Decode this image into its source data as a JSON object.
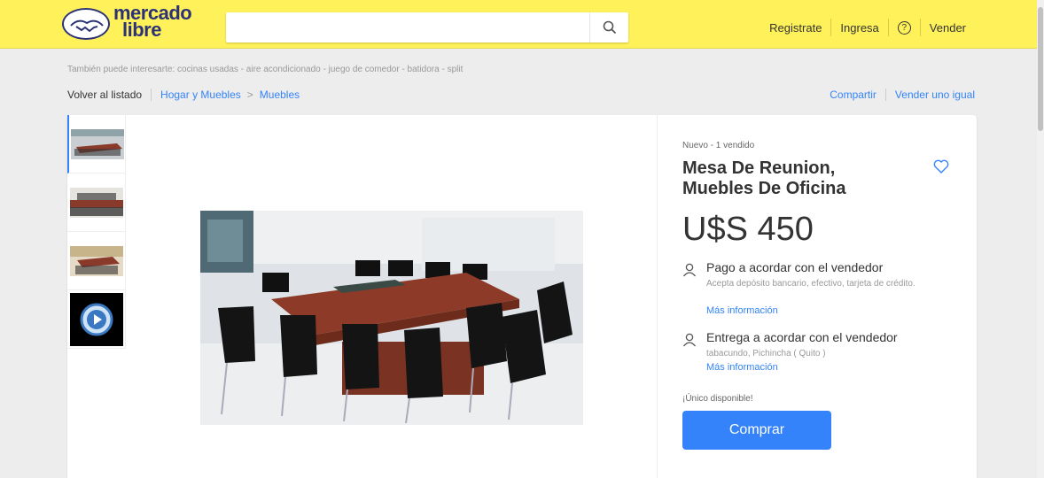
{
  "header": {
    "logo_line1": "mercado",
    "logo_line2": "libre",
    "search_placeholder": "",
    "nav": {
      "register": "Registrate",
      "login": "Ingresa",
      "help": "?",
      "sell": "Vender"
    }
  },
  "related": "También puede interesarte: cocinas usadas - aire acondicionado - juego de comedor - batidora - split",
  "breadcrumb": {
    "back": "Volver al listado",
    "cat1": "Hogar y Muebles",
    "cat2": "Muebles"
  },
  "actions": {
    "share": "Compartir",
    "sell_same": "Vender uno igual"
  },
  "product": {
    "condition": "Nuevo - 1 vendido",
    "title": "Mesa De Reunion, Muebles De Oficina",
    "price": "U$S 450",
    "payment": {
      "title": "Pago a acordar con el vendedor",
      "detail": "Acepta depósito bancario, efectivo, tarjeta de crédito.",
      "more": "Más información"
    },
    "delivery": {
      "title": "Entrega a acordar con el vendedor",
      "detail": "tabacundo, Pichincha ( Quito )",
      "more": "Más información"
    },
    "stock": "¡Único disponible!",
    "buy_label": "Comprar"
  },
  "colors": {
    "brand_yellow": "#fff159",
    "link_blue": "#3483fa",
    "logo_navy": "#2d3277"
  }
}
